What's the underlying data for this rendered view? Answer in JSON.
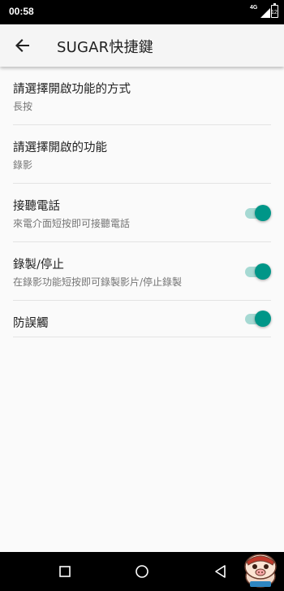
{
  "status_bar": {
    "time": "00:58",
    "network": "4G",
    "battery": "12"
  },
  "app_bar": {
    "title": "SUGAR快捷鍵"
  },
  "settings": [
    {
      "title": "請選擇開啟功能的方式",
      "subtitle": "長按"
    },
    {
      "title": "請選擇開啟的功能",
      "subtitle": "錄影"
    },
    {
      "title": "接聽電話",
      "subtitle": "來電介面短按即可接聽電話",
      "toggle_on": true
    },
    {
      "title": "錄製/停止",
      "subtitle": "在錄影功能短按即可錄製影片/停止錄製",
      "toggle_on": true
    },
    {
      "title": "防誤觸",
      "toggle_on": true
    }
  ],
  "colors": {
    "accent": "#009688",
    "accent_track": "#a6d9d3"
  }
}
